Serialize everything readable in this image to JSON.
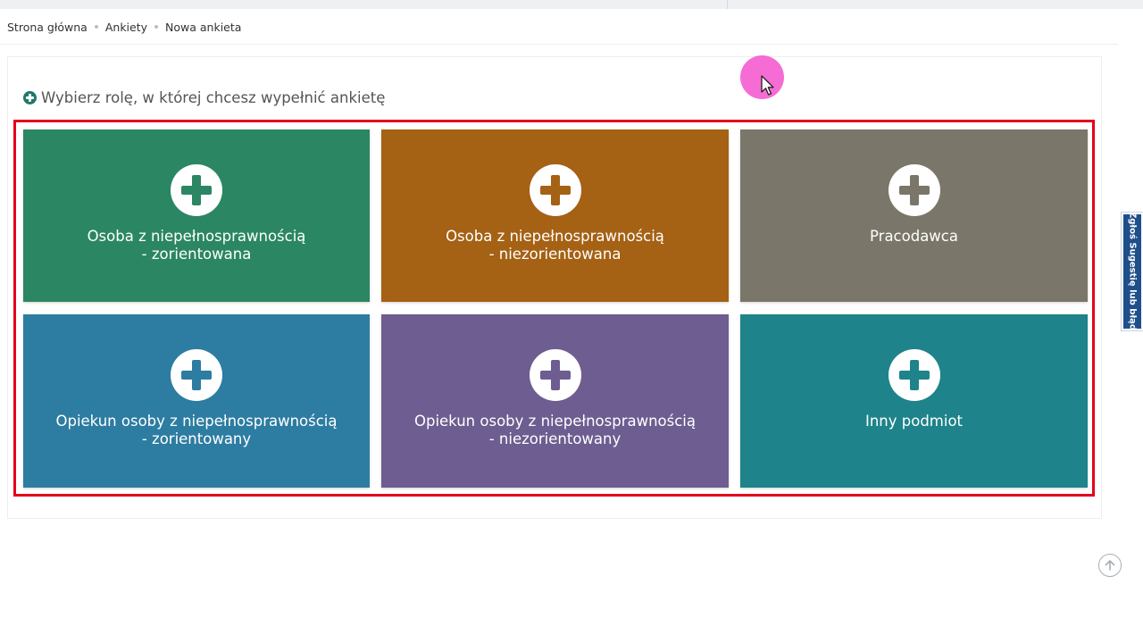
{
  "breadcrumb": {
    "items": [
      "Strona główna",
      "Ankiety",
      "Nowa ankieta"
    ]
  },
  "section": {
    "title": "Wybierz rolę, w której chcesz wypełnić ankietę"
  },
  "tiles": [
    {
      "line1": "Osoba z niepełnosprawnością",
      "line2": "- zorientowana",
      "color": "#2b8663",
      "icon": "plus-circle-icon"
    },
    {
      "line1": "Osoba z niepełnosprawnością",
      "line2": "- niezorientowana",
      "color": "#a56114",
      "icon": "plus-circle-icon"
    },
    {
      "line1": "Pracodawca",
      "line2": "",
      "color": "#7a7669",
      "icon": "plus-circle-icon"
    },
    {
      "line1": "Opiekun osoby z niepełnosprawnością",
      "line2": "- zorientowany",
      "color": "#2d7ca1",
      "icon": "plus-circle-icon"
    },
    {
      "line1": "Opiekun osoby z niepełnosprawnością",
      "line2": "- niezorientowany",
      "color": "#6d5d90",
      "icon": "plus-circle-icon"
    },
    {
      "line1": "Inny podmiot",
      "line2": "",
      "color": "#1e838a",
      "icon": "plus-circle-icon"
    }
  ],
  "feedback": {
    "label": "Zgłoś Sugestię lub błąd"
  },
  "colors": {
    "accent": "#22786a",
    "highlight_border": "#e3001b",
    "feedback_bg": "#1f4f8a",
    "cursor_halo": "#f442c9"
  }
}
